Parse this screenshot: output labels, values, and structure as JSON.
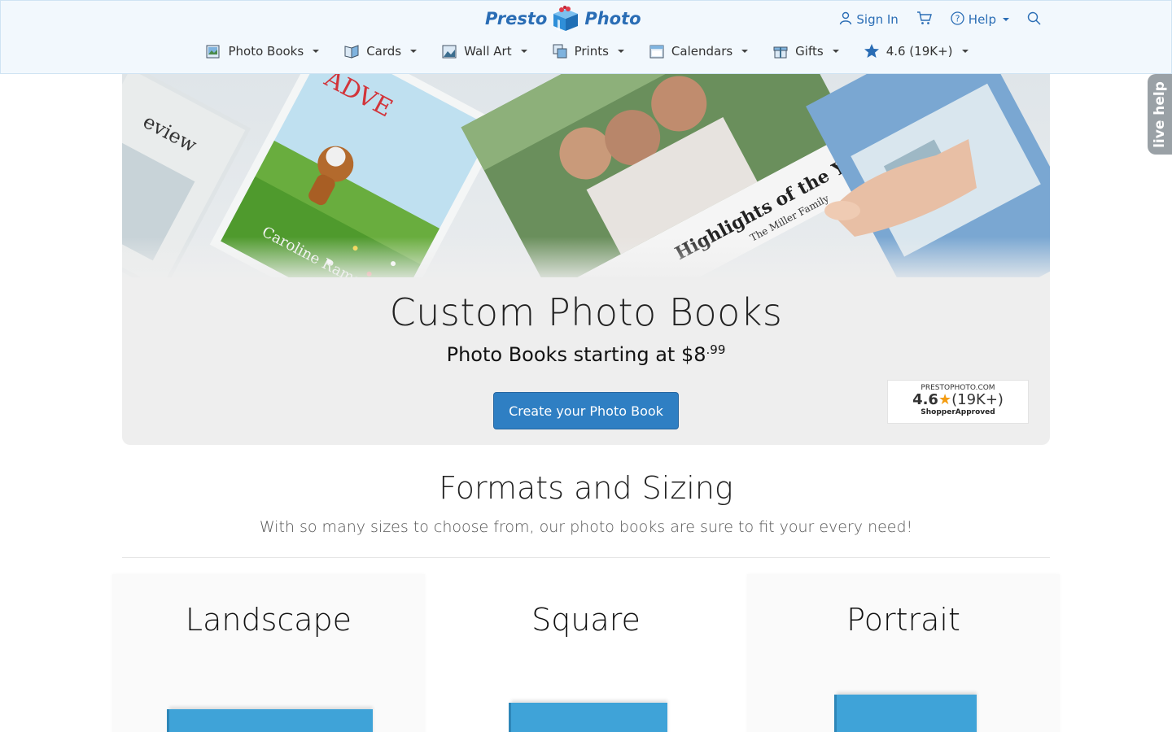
{
  "brand": {
    "left": "Presto",
    "right": "Photo"
  },
  "top_links": {
    "sign_in": "Sign In",
    "help": "Help"
  },
  "nav": [
    {
      "label": "Photo Books",
      "icon": "photo-book-icon"
    },
    {
      "label": "Cards",
      "icon": "cards-icon"
    },
    {
      "label": "Wall Art",
      "icon": "wall-art-icon"
    },
    {
      "label": "Prints",
      "icon": "prints-icon"
    },
    {
      "label": "Calendars",
      "icon": "calendar-icon"
    },
    {
      "label": "Gifts",
      "icon": "gifts-icon"
    },
    {
      "label": "4.6 (19K+)",
      "icon": "star-icon"
    }
  ],
  "hero": {
    "title": "Custom Photo Books",
    "subtitle_main": "Photo Books starting at $8",
    "subtitle_cents": ".99",
    "cta": "Create your Photo Book",
    "book_text_1": "Highlights of the Year",
    "book_text_2": "The Miller Family",
    "book_text_3": "Caroline Ramsey",
    "book_text_4": "ADVE",
    "book_text_5": "eview"
  },
  "badge": {
    "site": "PRESTOPHOTO.COM",
    "score": "4.6",
    "count": "(19K+)",
    "name": "ShopperApproved"
  },
  "live_help": "live help",
  "formats": {
    "title": "Formats and Sizing",
    "description": "With so many sizes to choose from, our photo books are sure to fit your every need!",
    "cards": [
      "Landscape",
      "Square",
      "Portrait"
    ]
  },
  "colors": {
    "brand_blue": "#2a6db5",
    "cta_blue": "#2f7fc3",
    "book_blue": "#3fa3d8",
    "header_bg": "#f2f8fd"
  }
}
